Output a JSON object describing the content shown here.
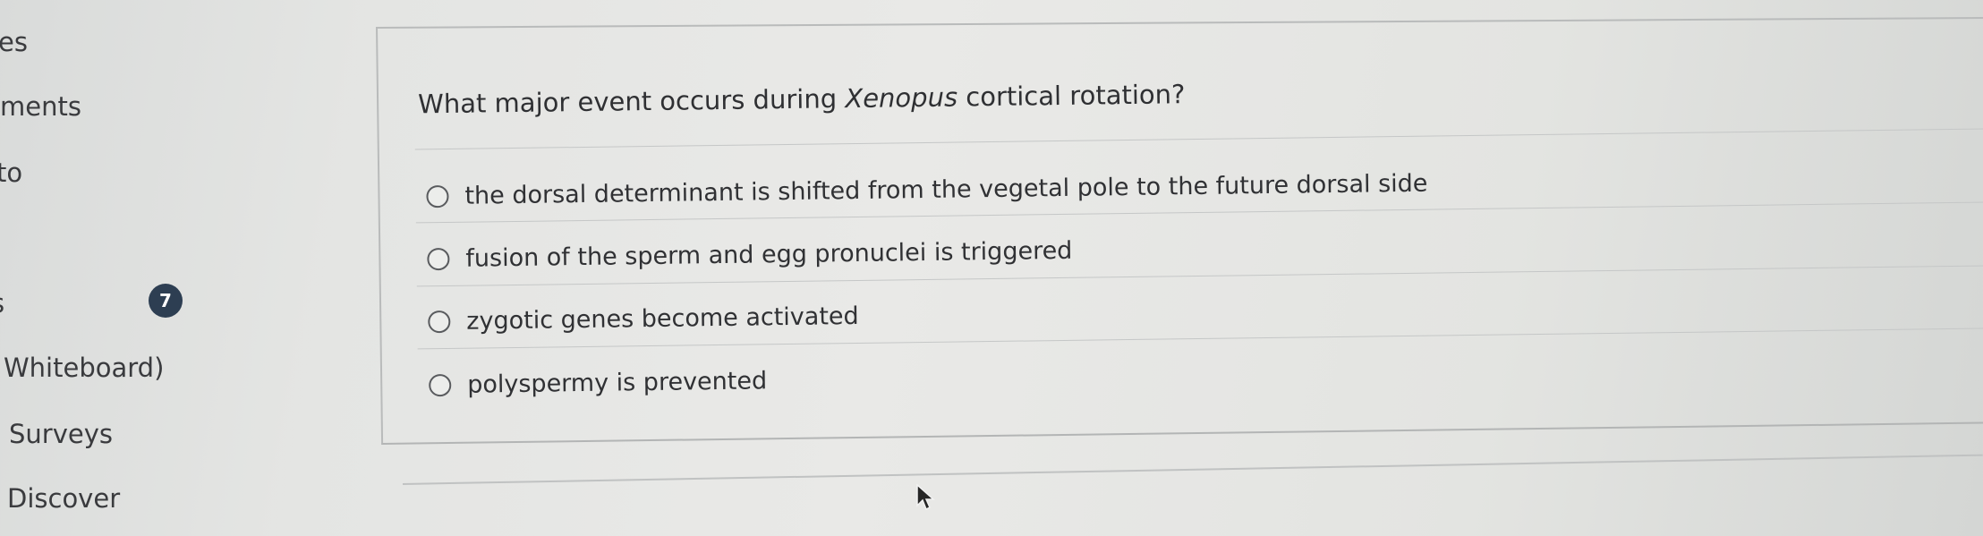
{
  "sidebar": {
    "items": [
      {
        "label": "es"
      },
      {
        "label": "ments"
      },
      {
        "label": "to"
      },
      {
        "label": "s"
      },
      {
        "label": "Whiteboard)"
      },
      {
        "label": "Surveys"
      },
      {
        "label": "Discover"
      }
    ],
    "badge_count": "7"
  },
  "question": {
    "text_before": "What major event occurs during ",
    "text_italic": "Xenopus",
    "text_after": " cortical rotation?",
    "answers": [
      {
        "label": "the dorsal determinant is shifted from the vegetal pole to the future dorsal side"
      },
      {
        "label": "fusion of the sperm and egg pronuclei is triggered"
      },
      {
        "label": "zygotic genes become activated"
      },
      {
        "label": "polyspermy is prevented"
      }
    ]
  },
  "colors": {
    "badge": "#2d3e52",
    "background": "#e8e8e6",
    "text": "#2e2f31"
  }
}
